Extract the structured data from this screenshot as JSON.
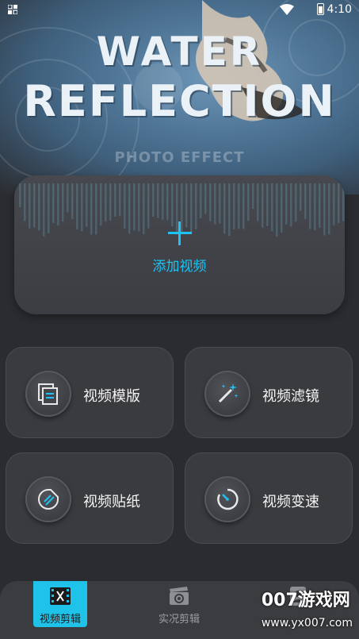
{
  "status_bar": {
    "time": "4:10",
    "icons": [
      "notification-icon",
      "wifi-icon",
      "battery-icon"
    ]
  },
  "hero": {
    "title_line1": "WATER",
    "title_line2": "REFLECTION",
    "subtitle": "PHOTO EFFECT"
  },
  "add_video": {
    "icon": "plus-icon",
    "label": "添加视频",
    "accent": "#1ec3f5"
  },
  "features": [
    {
      "label": "视频模版",
      "icon": "template-icon"
    },
    {
      "label": "视频滤镜",
      "icon": "magic-wand-icon"
    },
    {
      "label": "视频贴纸",
      "icon": "sticker-icon"
    },
    {
      "label": "视频变速",
      "icon": "speed-icon"
    }
  ],
  "bottom_nav": [
    {
      "label": "视频剪辑",
      "icon": "film-scissors-icon",
      "active": true
    },
    {
      "label": "实况剪辑",
      "icon": "clapper-icon",
      "active": false
    },
    {
      "label": "",
      "icon": "profile-icon",
      "active": false
    }
  ],
  "watermark": {
    "main": "007游戏网",
    "sub": "www.yx007.com"
  }
}
